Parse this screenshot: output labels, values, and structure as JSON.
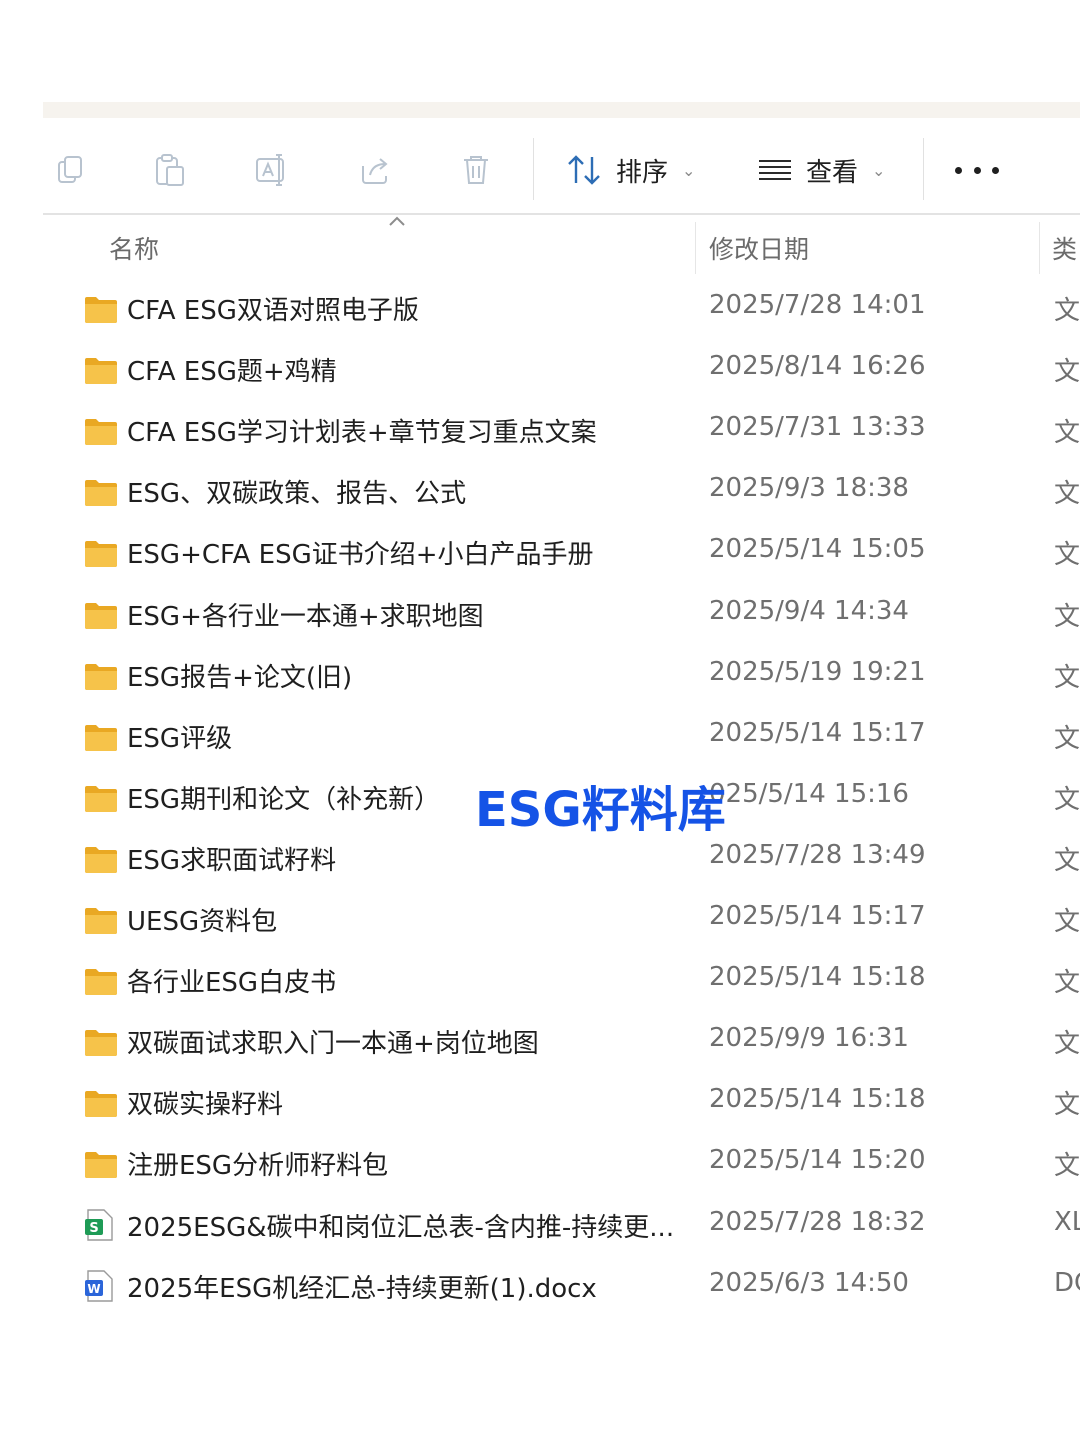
{
  "toolbar": {
    "sort_label": "排序",
    "view_label": "查看",
    "icons": [
      "copy-icon",
      "paste-icon",
      "rename-icon",
      "share-icon",
      "delete-icon",
      "sort-icon",
      "view-icon",
      "more-icon"
    ]
  },
  "columns": {
    "name": "名称",
    "modified": "修改日期",
    "type": "类"
  },
  "files": [
    {
      "name": "CFA ESG双语对照电子版",
      "date": "2025/7/28 14:01",
      "type": "文",
      "icon": "folder"
    },
    {
      "name": "CFA ESG题+鸡精",
      "date": "2025/8/14 16:26",
      "type": "文",
      "icon": "folder"
    },
    {
      "name": "CFA ESG学习计划表+章节复习重点文案",
      "date": "2025/7/31 13:33",
      "type": "文",
      "icon": "folder"
    },
    {
      "name": "ESG、双碳政策、报告、公式",
      "date": "2025/9/3 18:38",
      "type": "文",
      "icon": "folder"
    },
    {
      "name": "ESG+CFA ESG证书介绍+小白产品手册",
      "date": "2025/5/14 15:05",
      "type": "文",
      "icon": "folder"
    },
    {
      "name": "ESG+各行业一本通+求职地图",
      "date": "2025/9/4 14:34",
      "type": "文",
      "icon": "folder"
    },
    {
      "name": "ESG报告+论文(旧)",
      "date": "2025/5/19 19:21",
      "type": "文",
      "icon": "folder"
    },
    {
      "name": "ESG评级",
      "date": "2025/5/14 15:17",
      "type": "文",
      "icon": "folder"
    },
    {
      "name": "ESG期刊和论文（补充新）",
      "date": "025/5/14 15:16",
      "type": "文",
      "icon": "folder"
    },
    {
      "name": "ESG求职面试籽料",
      "date": "2025/7/28 13:49",
      "type": "文",
      "icon": "folder"
    },
    {
      "name": "UESG资料包",
      "date": "2025/5/14 15:17",
      "type": "文",
      "icon": "folder"
    },
    {
      "name": "各行业ESG白皮书",
      "date": "2025/5/14 15:18",
      "type": "文",
      "icon": "folder"
    },
    {
      "name": "双碳面试求职入门一本通+岗位地图",
      "date": "2025/9/9 16:31",
      "type": "文",
      "icon": "folder"
    },
    {
      "name": "双碳实操籽料",
      "date": "2025/5/14 15:18",
      "type": "文",
      "icon": "folder"
    },
    {
      "name": "注册ESG分析师籽料包",
      "date": "2025/5/14 15:20",
      "type": "文",
      "icon": "folder"
    },
    {
      "name": "2025ESG&碳中和岗位汇总表-含内推-持续更...",
      "date": "2025/7/28 18:32",
      "type": "XL",
      "icon": "spreadsheet"
    },
    {
      "name": "2025年ESG机经汇总-持续更新(1).docx",
      "date": "2025/6/3 14:50",
      "type": "DC",
      "icon": "word"
    }
  ],
  "overlay": {
    "text": "ESG籽料库"
  },
  "colors": {
    "folder": "#f6c34a",
    "spreadsheet": "#1e9b56",
    "word": "#2b65d9",
    "overlay": "#1553e6"
  }
}
